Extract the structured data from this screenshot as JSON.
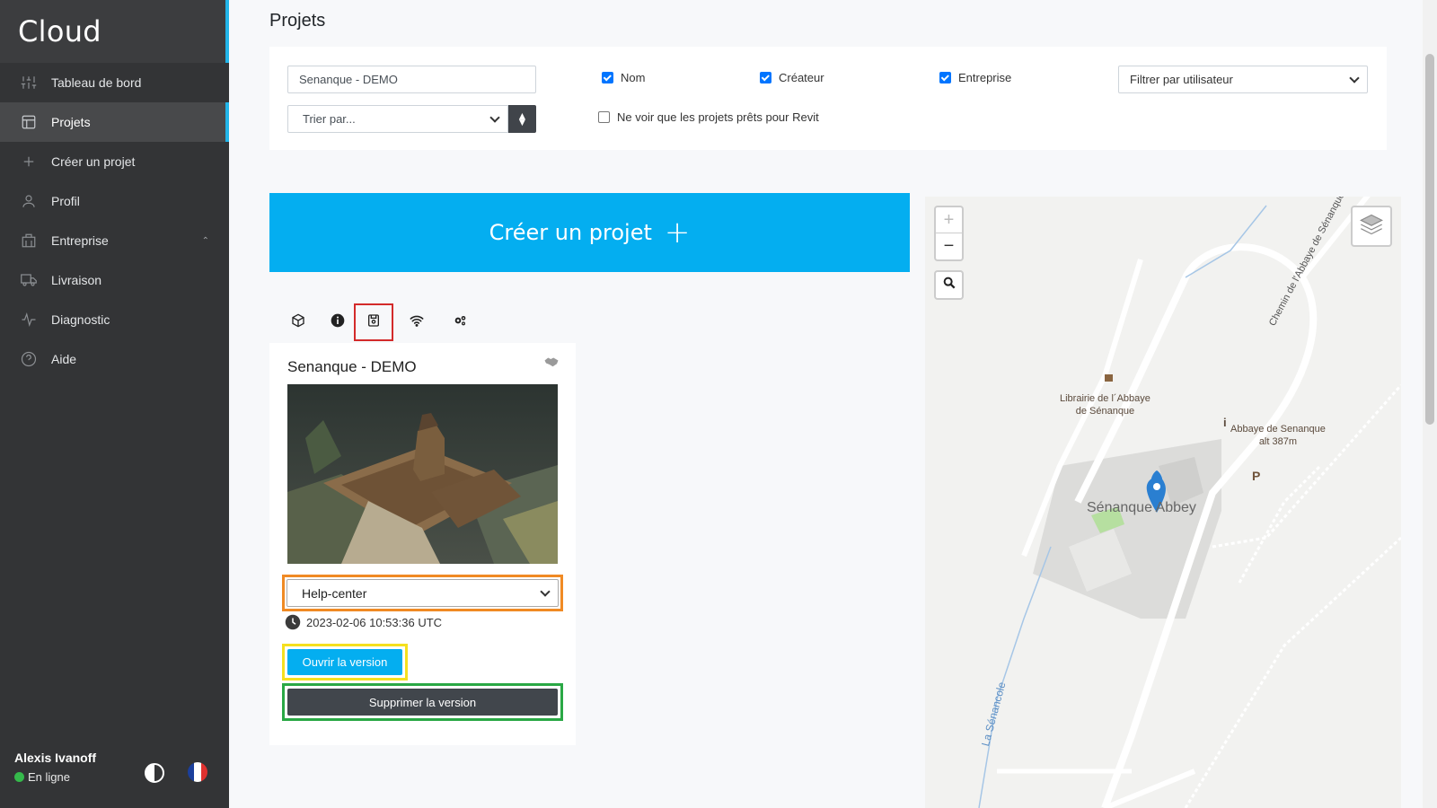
{
  "app": {
    "brand": "Cloud"
  },
  "sidebar": {
    "items": [
      {
        "label": "Tableau de bord",
        "icon": "sliders-icon"
      },
      {
        "label": "Projets",
        "icon": "layout-icon",
        "active": true
      },
      {
        "label": "Créer un projet",
        "icon": "plus-icon"
      },
      {
        "label": "Profil",
        "icon": "user-icon"
      },
      {
        "label": "Entreprise",
        "icon": "building-icon",
        "expandable": true
      },
      {
        "label": "Livraison",
        "icon": "truck-icon"
      },
      {
        "label": "Diagnostic",
        "icon": "activity-icon"
      },
      {
        "label": "Aide",
        "icon": "help-circle-icon"
      }
    ],
    "user": {
      "name": "Alexis Ivanoff",
      "status": "En ligne",
      "status_color": "#35b94b"
    }
  },
  "page": {
    "title": "Projets"
  },
  "filters": {
    "search_value": "Senanque - DEMO",
    "sort_placeholder": "Trier par...",
    "checkboxes": {
      "name": {
        "label": "Nom",
        "checked": true
      },
      "creator": {
        "label": "Créateur",
        "checked": true
      },
      "company": {
        "label": "Entreprise",
        "checked": true
      },
      "revit_only": {
        "label": "Ne voir que les projets prêts pour Revit",
        "checked": false
      }
    },
    "user_filter": "Filtrer par utilisateur"
  },
  "create_button": {
    "label": "Créer un projet",
    "plus": "+"
  },
  "project": {
    "name": "Senanque - DEMO",
    "version": "Help-center",
    "date": "2023-02-06 10:53:36 UTC",
    "open_label": "Ouvrir la version",
    "delete_label": "Supprimer la version"
  },
  "map": {
    "zoom_in": "+",
    "zoom_out": "−",
    "labels": {
      "bookshop_line1": "Librairie de l´Abbaye",
      "bookshop_line2": "de Sénanque",
      "abbey_line1": "Abbaye de Senanque",
      "abbey_line2": "alt 387m",
      "abbey_name": "Sénanque Abbey",
      "road": "Chemin de l'Abbaye de Sénanque",
      "river": "La Sénancole",
      "parking": "P",
      "info": "i"
    }
  },
  "colors": {
    "accent": "#04aef0",
    "sidebar_bg": "#333436",
    "dark_button": "#41464c",
    "highlight_red": "#d32a2a",
    "highlight_orange": "#f08a24",
    "highlight_yellow": "#f5e01f",
    "highlight_green": "#2aa845"
  }
}
